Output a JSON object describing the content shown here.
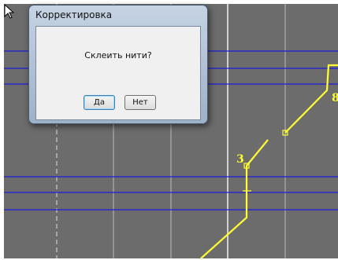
{
  "dialog": {
    "title": "Корректировка",
    "message": "Склеить нити?",
    "buttons": {
      "yes": "Да",
      "no": "Нет"
    }
  },
  "drawing": {
    "labels": {
      "marker_3": "3",
      "marker_8": "8"
    },
    "colors": {
      "background": "#6c6c6c",
      "blue_line": "#1d1dd6",
      "yellow_line": "#ffff33",
      "grid_line": "#bdbdbd",
      "dashed_line": "#e0e0e0"
    }
  }
}
